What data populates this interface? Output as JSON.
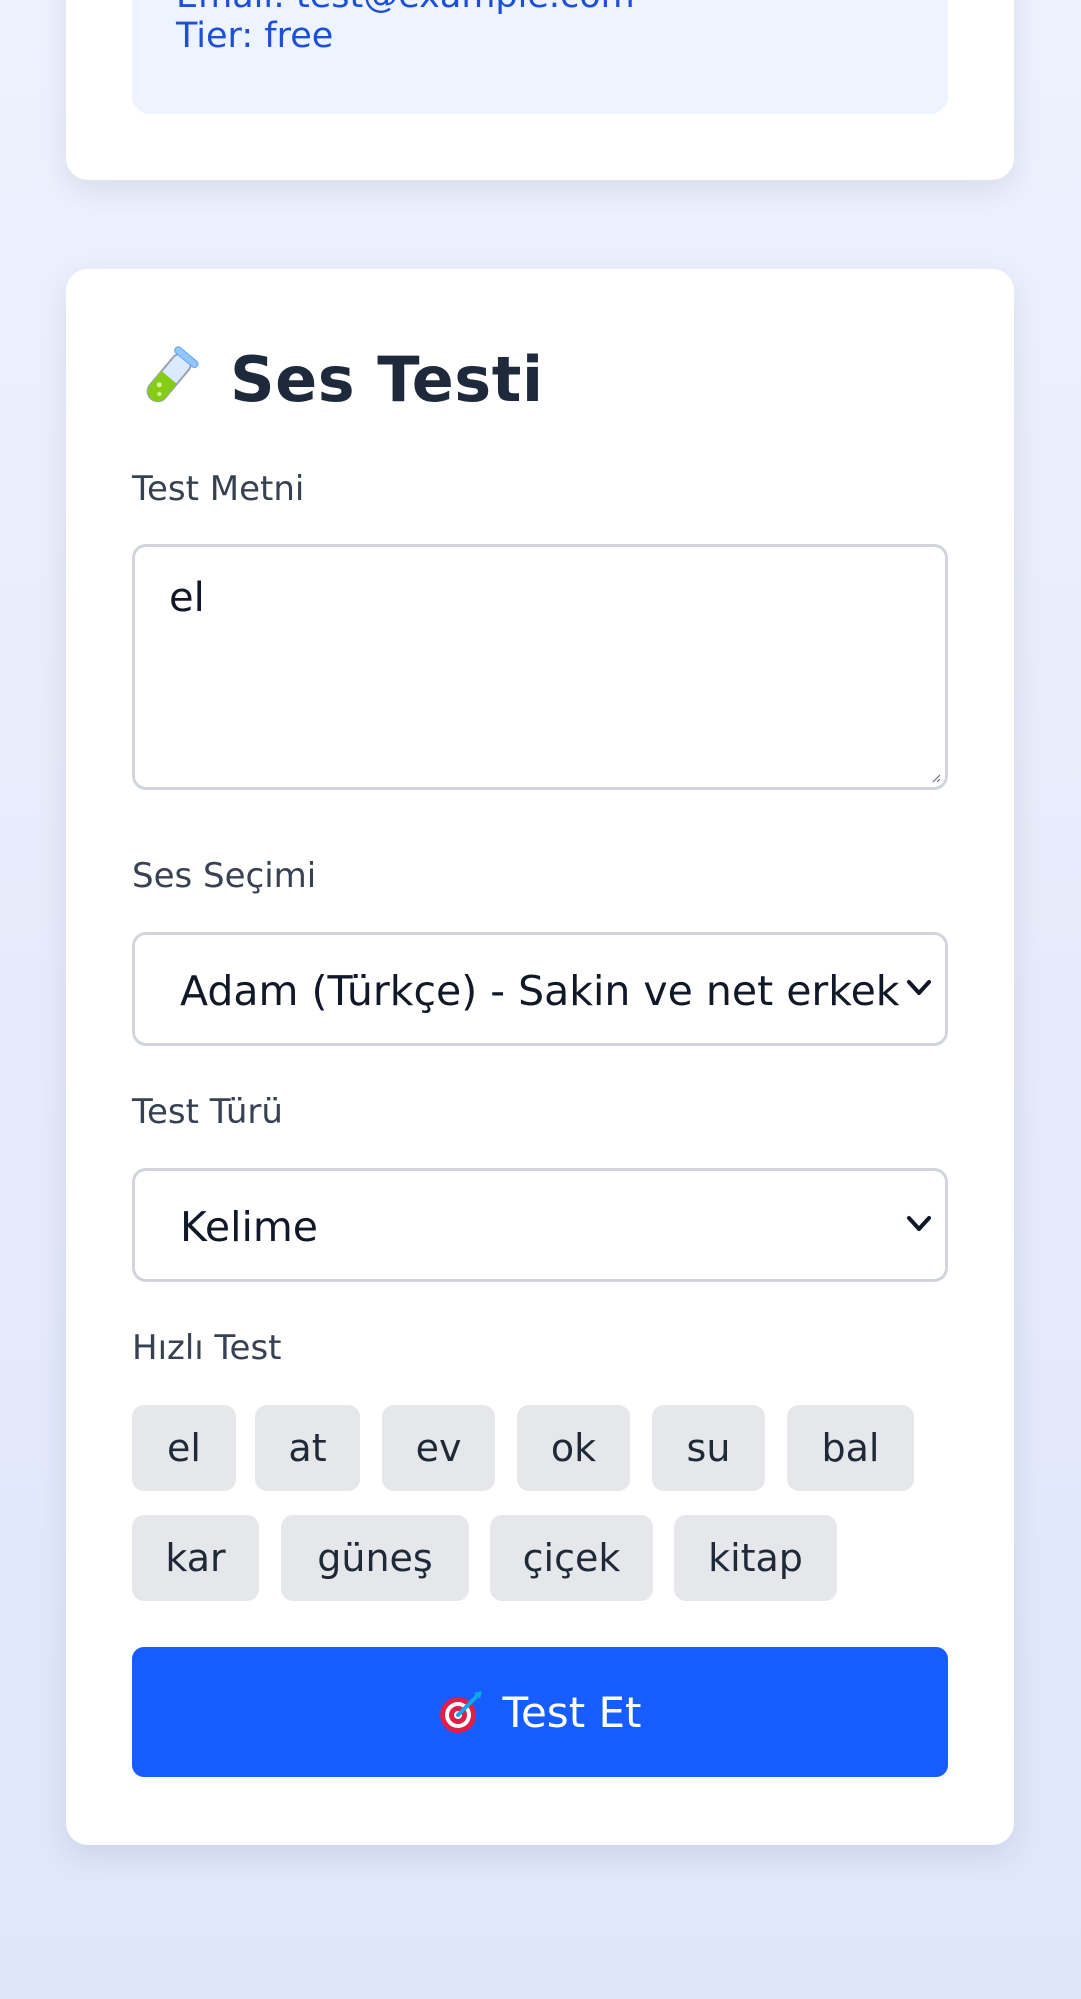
{
  "account": {
    "email_line": "Email: test@example.com",
    "tier_line": "Tier: free"
  },
  "voice_test": {
    "title": "Ses Testi",
    "title_icon": "test-tube-icon",
    "text_label": "Test Metni",
    "text_value": "el",
    "voice_label": "Ses Seçimi",
    "voice_selected": "Adam (Türkçe) - Sakin ve net erkek",
    "type_label": "Test Türü",
    "type_selected": "Kelime",
    "quick_label": "Hızlı Test",
    "quick_words": [
      "el",
      "at",
      "ev",
      "ok",
      "su",
      "bal",
      "kar",
      "güneş",
      "çiçek",
      "kitap"
    ],
    "submit_label": "Test Et",
    "submit_icon": "target-icon"
  },
  "colors": {
    "accent": "#175cff",
    "link_blue": "#1d4ed8",
    "info_bg": "#eef4ff",
    "chip_bg": "#e5e7eb"
  }
}
